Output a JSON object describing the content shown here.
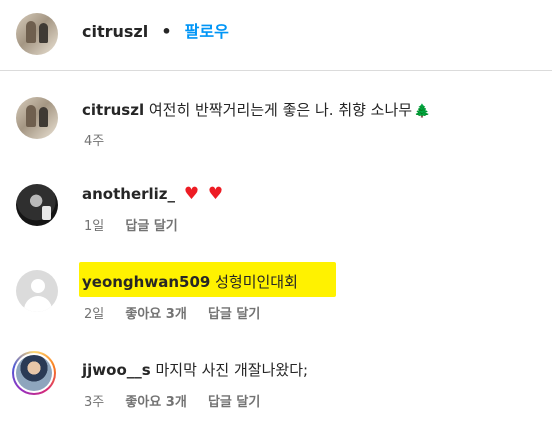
{
  "header": {
    "username": "citruszl",
    "dot": "•",
    "follow": "팔로우"
  },
  "comments": [
    {
      "username": "citruszl",
      "text": "여전히 반짝거리는게 좋은 나. 취향 소나무",
      "emoji": "🌲",
      "time": "4주",
      "likes": "",
      "reply": ""
    },
    {
      "username": "anotherliz_",
      "hearts": [
        "♥",
        "♥"
      ],
      "time": "1일",
      "reply": "답글 달기"
    },
    {
      "username": "yeonghwan509",
      "text": "성형미인대회",
      "time": "2일",
      "likes": "좋아요 3개",
      "reply": "답글 달기"
    },
    {
      "username": "jjwoo__s",
      "text": "마지막 사진 개잘나왔다;",
      "time": "3주",
      "likes": "좋아요 3개",
      "reply": "답글 달기"
    }
  ],
  "colors": {
    "accent": "#0095f6",
    "heart": "#ed1c24",
    "highlight": "#fff200"
  },
  "icons": {
    "heart": "heart-icon",
    "tree": "tree-icon"
  }
}
